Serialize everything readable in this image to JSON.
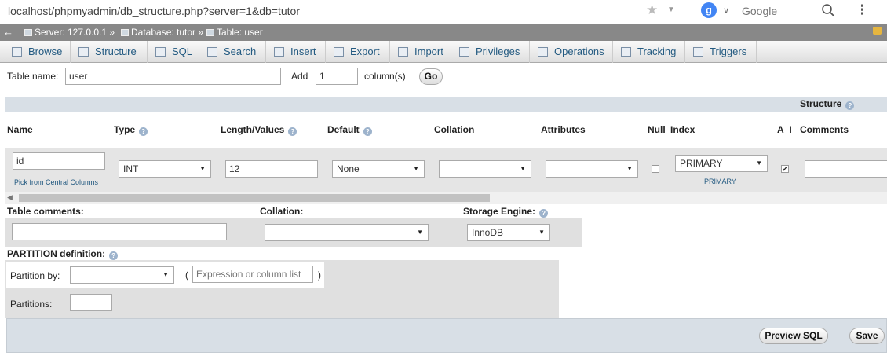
{
  "browser": {
    "url": "localhost/phpmyadmin/db_structure.php?server=1&db=tutor",
    "search_engine": "Google",
    "icons": [
      "star-icon",
      "google-icon",
      "search-icon",
      "menu-icon"
    ]
  },
  "breadcrumb": {
    "server": "Server: 127.0.0.1 »",
    "database": "Database: tutor »",
    "table": "Table: user"
  },
  "tabs": [
    {
      "label": "Browse",
      "icon": "browse-icon"
    },
    {
      "label": "Structure",
      "icon": "structure-icon"
    },
    {
      "label": "SQL",
      "icon": "sql-icon"
    },
    {
      "label": "Search",
      "icon": "search-icon"
    },
    {
      "label": "Insert",
      "icon": "insert-icon"
    },
    {
      "label": "Export",
      "icon": "export-icon"
    },
    {
      "label": "Import",
      "icon": "import-icon"
    },
    {
      "label": "Privileges",
      "icon": "privileges-icon"
    },
    {
      "label": "Operations",
      "icon": "operations-icon"
    },
    {
      "label": "Tracking",
      "icon": "tracking-icon"
    },
    {
      "label": "Triggers",
      "icon": "triggers-icon"
    }
  ],
  "table_name": {
    "label": "Table name:",
    "value": "user",
    "add_label": "Add",
    "add_value": "1",
    "columns_label": "column(s)",
    "go_label": "Go"
  },
  "structure": {
    "title": "Structure",
    "headers": {
      "name": "Name",
      "type": "Type",
      "length": "Length/Values",
      "default": "Default",
      "collation": "Collation",
      "attributes": "Attributes",
      "null": "Null",
      "index": "Index",
      "ai": "A_I",
      "comments": "Comments"
    },
    "row": {
      "name": "id",
      "central_link": "Pick from Central Columns",
      "type": "INT",
      "length": "12",
      "default": "None",
      "collation": "",
      "attributes": "",
      "null_checked": false,
      "index": "PRIMARY",
      "index_note": "PRIMARY",
      "ai_checked": true,
      "comments": ""
    }
  },
  "table_options": {
    "comments_label": "Table comments:",
    "comments_value": "",
    "collation_label": "Collation:",
    "collation_value": "",
    "engine_label": "Storage Engine:",
    "engine_value": "InnoDB"
  },
  "partition": {
    "title": "PARTITION definition:",
    "by_label": "Partition by:",
    "by_value": "",
    "open_paren": "(",
    "expression_placeholder": "Expression or column list",
    "close_paren": ")",
    "partitions_label": "Partitions:",
    "partitions_value": ""
  },
  "footer": {
    "preview_label": "Preview SQL",
    "save_label": "Save"
  }
}
